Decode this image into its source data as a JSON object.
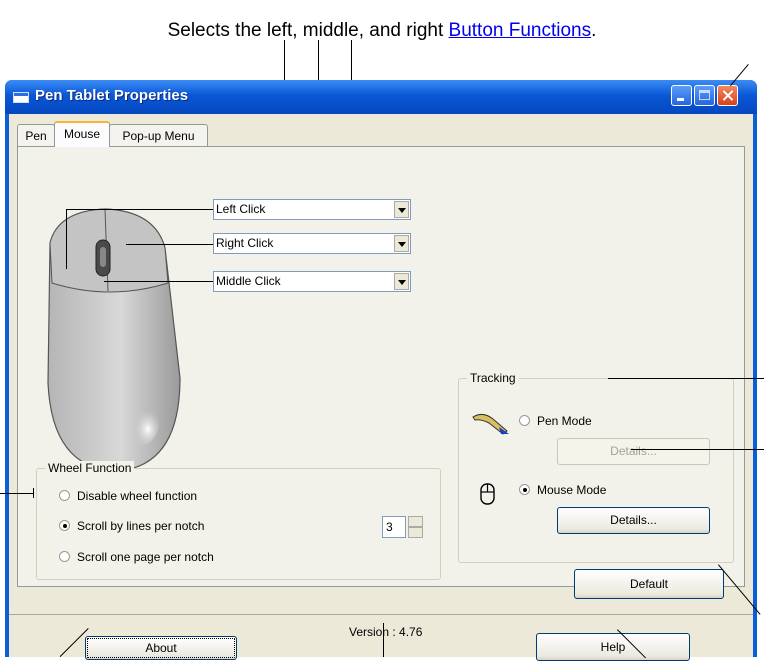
{
  "caption": {
    "prefix": "Selects the left, middle, and right ",
    "link": "Button Functions",
    "suffix": "."
  },
  "window": {
    "title": "Pen Tablet Properties"
  },
  "tabs": [
    "Pen",
    "Mouse",
    "Pop-up Menu"
  ],
  "active_tab": "Mouse",
  "buttons_dropdowns": {
    "left": "Left Click",
    "right": "Right Click",
    "middle": "Middle Click"
  },
  "wheel": {
    "group_label": "Wheel Function",
    "options": [
      "Disable wheel function",
      "Scroll by lines per notch",
      "Scroll one page per notch"
    ],
    "selected": "Scroll by lines per notch",
    "lines_value": "3"
  },
  "tracking": {
    "group_label": "Tracking",
    "pen_mode": "Pen Mode",
    "mouse_mode": "Mouse Mode",
    "selected": "Mouse Mode",
    "details_label": "Details..."
  },
  "footer": {
    "default_label": "Default",
    "about_label": "About",
    "version_text": "Version : 4.76",
    "help_label": "Help"
  },
  "colors": {
    "titlebar": "#0a57d6",
    "dialog_bg": "#ece9d8",
    "link": "#0000ee"
  }
}
